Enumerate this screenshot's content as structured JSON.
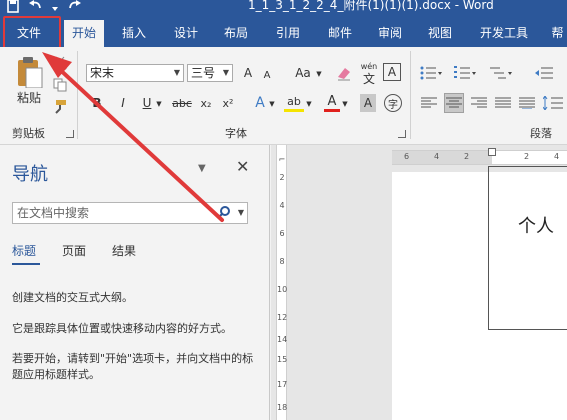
{
  "window": {
    "title": "1_1_3_1_2_2_4_附件(1)(1)(1).docx - Word"
  },
  "tabs": [
    {
      "id": "file",
      "label": "文件"
    },
    {
      "id": "home",
      "label": "开始"
    },
    {
      "id": "insert",
      "label": "插入"
    },
    {
      "id": "design",
      "label": "设计"
    },
    {
      "id": "layout",
      "label": "布局"
    },
    {
      "id": "references",
      "label": "引用"
    },
    {
      "id": "mailings",
      "label": "邮件"
    },
    {
      "id": "review",
      "label": "审阅"
    },
    {
      "id": "view",
      "label": "视图"
    },
    {
      "id": "developer",
      "label": "开发工具"
    },
    {
      "id": "help",
      "label": "帮"
    }
  ],
  "ribbon": {
    "clipboard": {
      "paste_label": "粘贴",
      "group_label": "剪贴板"
    },
    "font": {
      "font_name": "宋末",
      "font_size": "三号",
      "wen_label": "wén",
      "wen_char": "文",
      "group_label": "字体",
      "grow": "A",
      "shrink": "A",
      "aa": "Aa",
      "bold": "B",
      "italic": "I",
      "underline": "U",
      "strike": "abc",
      "sub": "x₂",
      "sup": "x²",
      "effects": "A",
      "highlight": "ab",
      "color": "A",
      "char_shade": "A",
      "enclose": "字",
      "border": "A"
    },
    "paragraph": {
      "group_label": "段落"
    }
  },
  "nav": {
    "title": "导航",
    "search_placeholder": "在文档中搜索",
    "tabs": [
      "标题",
      "页面",
      "结果"
    ],
    "text1": "创建文档的交互式大纲。",
    "text2": "它是跟踪具体位置或快速移动内容的好方式。",
    "text3": "若要开始，请转到\"开始\"选项卡，并向文档中的标题应用标题样式。"
  },
  "ruler": {
    "h_left": [
      "6",
      "4",
      "2"
    ],
    "h_right": [
      "2",
      "4"
    ],
    "v": [
      "2",
      "4",
      "6",
      "8",
      "10",
      "12",
      "14",
      "15",
      "17",
      "18"
    ]
  },
  "document": {
    "text": "个人"
  },
  "colors": {
    "word_blue": "#2b579a",
    "annotation_red": "#e03a3a"
  }
}
